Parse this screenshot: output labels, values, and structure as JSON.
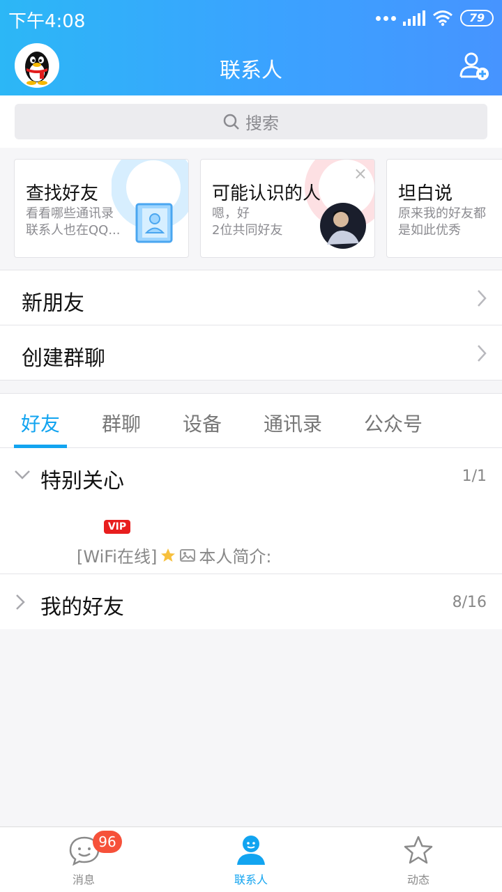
{
  "status_bar": {
    "time": "下午4:08",
    "battery": "79"
  },
  "header": {
    "title": "联系人"
  },
  "search": {
    "placeholder": "搜索"
  },
  "cards": [
    {
      "title": "查找好友",
      "line1": "看看哪些通讯录",
      "line2": "联系人也在QQ..."
    },
    {
      "title": "可能认识的人",
      "line1": "嗯，好",
      "line2": "2位共同好友",
      "close": "×"
    },
    {
      "title": "坦白说",
      "line1": "原来我的好友都",
      "line2": "是如此优秀"
    }
  ],
  "rows": {
    "new_friends": "新朋友",
    "create_group": "创建群聊"
  },
  "tabs": [
    "好友",
    "群聊",
    "设备",
    "通讯录",
    "公众号"
  ],
  "groups": {
    "special": {
      "label": "特别关心",
      "count": "1/1"
    },
    "my_friends": {
      "label": "我的好友",
      "count": "8/16"
    }
  },
  "friend": {
    "vip": "VIP",
    "status": "[WiFi在线]",
    "bio": "本人简介:"
  },
  "nav": {
    "messages": {
      "label": "消息",
      "badge": "96"
    },
    "contacts": {
      "label": "联系人"
    },
    "feeds": {
      "label": "动态"
    }
  },
  "colors": {
    "accent": "#12a4f0",
    "header_start": "#2cb7f6",
    "header_end": "#4694ff",
    "badge": "#f6513a",
    "vip": "#e81e1e"
  }
}
